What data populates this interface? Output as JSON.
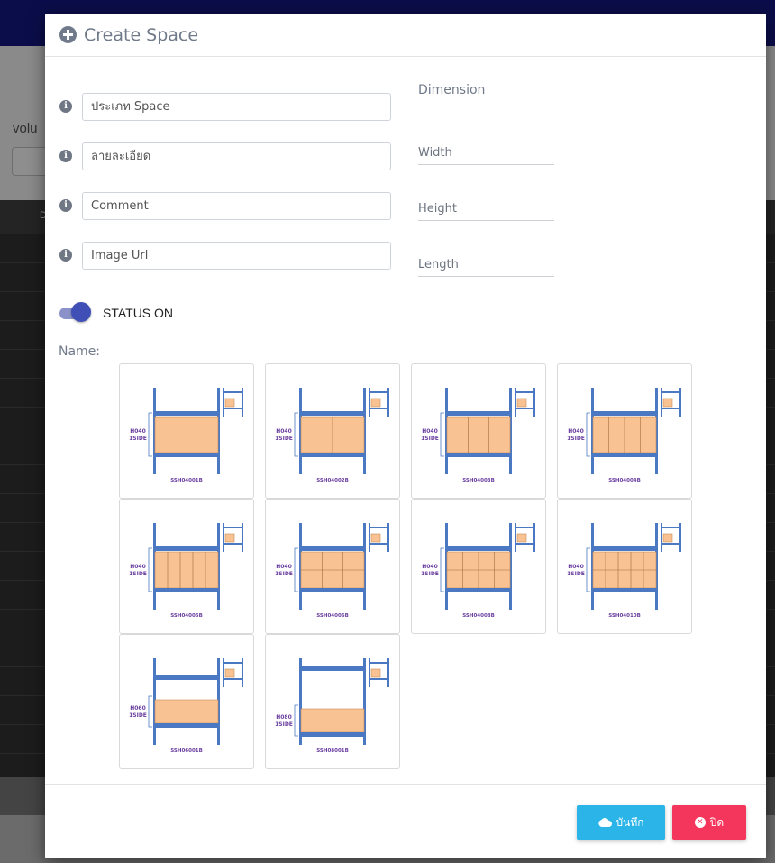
{
  "background": {
    "label": "volu",
    "column_header": "D"
  },
  "modal": {
    "title": "Create Space",
    "fields": {
      "type_placeholder": "ประเภท Space",
      "detail_placeholder": "ลายละเอียด",
      "comment_placeholder": "Comment",
      "image_url_placeholder": "Image Url"
    },
    "dimension": {
      "title": "Dimension",
      "width_placeholder": "Width",
      "height_placeholder": "Height",
      "length_placeholder": "Length"
    },
    "status": {
      "label": "STATUS ON",
      "on": true
    },
    "name_label": "Name:",
    "tiles": [
      {
        "code": "SSH04001B",
        "tag1": "H040",
        "tag2": "1SIDE",
        "cols": 1,
        "rows": 1
      },
      {
        "code": "SSH04002B",
        "tag1": "H040",
        "tag2": "1SIDE",
        "cols": 2,
        "rows": 1
      },
      {
        "code": "SSH04003B",
        "tag1": "H040",
        "tag2": "1SIDE",
        "cols": 3,
        "rows": 1
      },
      {
        "code": "SSH04004B",
        "tag1": "H040",
        "tag2": "1SIDE",
        "cols": 4,
        "rows": 1
      },
      {
        "code": "SSH04005B",
        "tag1": "H040",
        "tag2": "1SIDE",
        "cols": 5,
        "rows": 1
      },
      {
        "code": "SSH04006B",
        "tag1": "H040",
        "tag2": "1SIDE",
        "cols": 3,
        "rows": 2
      },
      {
        "code": "SSH04008B",
        "tag1": "H040",
        "tag2": "1SIDE",
        "cols": 4,
        "rows": 2
      },
      {
        "code": "SSH04010B",
        "tag1": "H040",
        "tag2": "1SIDE",
        "cols": 5,
        "rows": 2
      },
      {
        "code": "SSH06001B",
        "tag1": "H060",
        "tag2": "1SIDE",
        "cols": 1,
        "rows": 1
      },
      {
        "code": "SSH08001B",
        "tag1": "H080",
        "tag2": "1SIDE",
        "cols": 1,
        "rows": 1
      }
    ],
    "buttons": {
      "save": "บันทึก",
      "close": "ปิด"
    },
    "colors": {
      "save": "#2bb4e8",
      "close": "#f5365c",
      "toggle": "#3f4fb5",
      "rack_blue": "#4a78c2",
      "box_orange": "#f8c293"
    }
  }
}
